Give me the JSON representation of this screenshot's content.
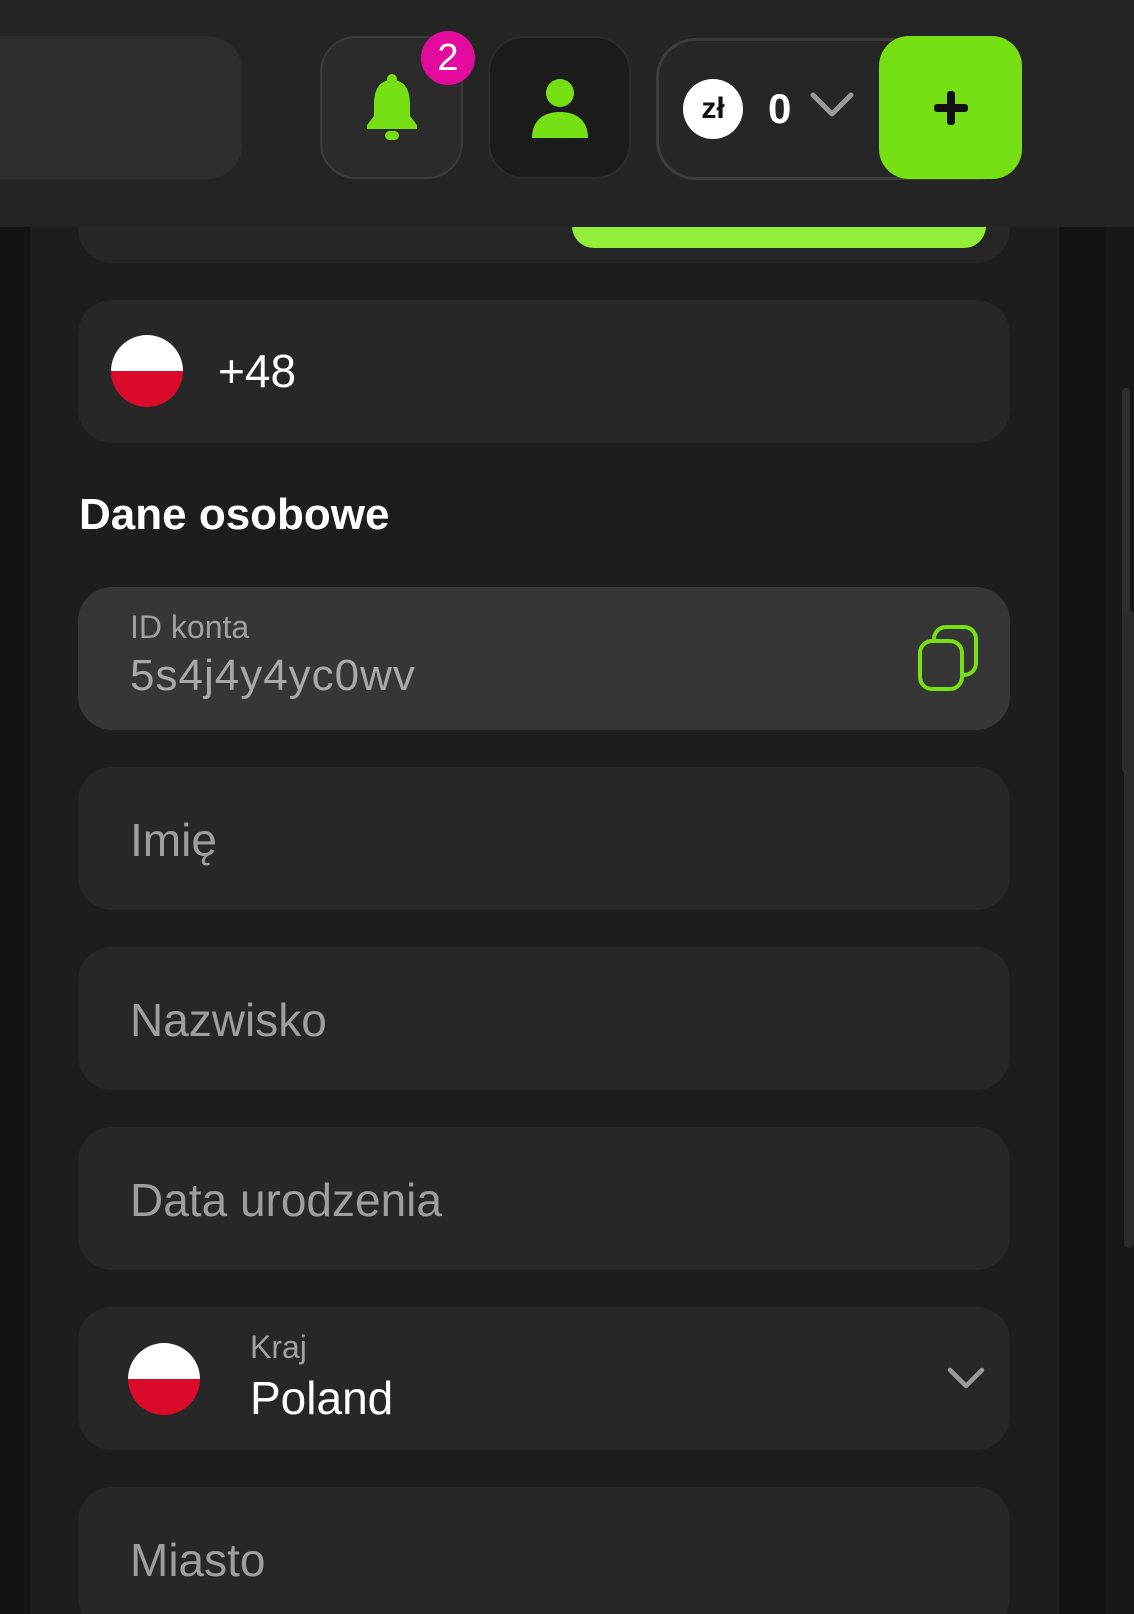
{
  "header": {
    "notifications_count": "2",
    "currency_symbol": "zł",
    "balance": "0",
    "icons": {
      "bell": "bell-icon",
      "user": "user-icon",
      "chevron": "chevron-down-icon",
      "plus": "plus-icon"
    },
    "colors": {
      "accent": "#77e015",
      "badge": "#e20b9d"
    }
  },
  "phone": {
    "code": "+48"
  },
  "personal_section": {
    "title": "Dane osobowe",
    "account_id": {
      "label": "ID konta",
      "value": "5s4j4y4yc0wv"
    },
    "first_name": {
      "placeholder": "Imię"
    },
    "last_name": {
      "placeholder": "Nazwisko"
    },
    "birth_date": {
      "placeholder": "Data urodzenia"
    },
    "country": {
      "label": "Kraj",
      "value": "Poland"
    },
    "city": {
      "placeholder": "Miasto"
    }
  }
}
